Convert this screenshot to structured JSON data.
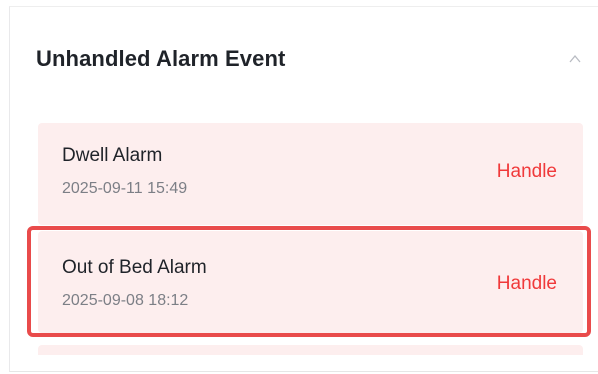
{
  "panel": {
    "title": "Unhandled Alarm Event",
    "collapse_icon": "chevron-up-icon"
  },
  "alarms": [
    {
      "title": "Dwell Alarm",
      "time": "2025-09-11 15:49",
      "action_label": "Handle"
    },
    {
      "title": "Out of Bed Alarm",
      "time": "2025-09-08 18:12",
      "action_label": "Handle"
    }
  ],
  "colors": {
    "item_background": "#fdeeee",
    "action_text": "#f0393a",
    "highlight_border": "#e94b4b"
  }
}
